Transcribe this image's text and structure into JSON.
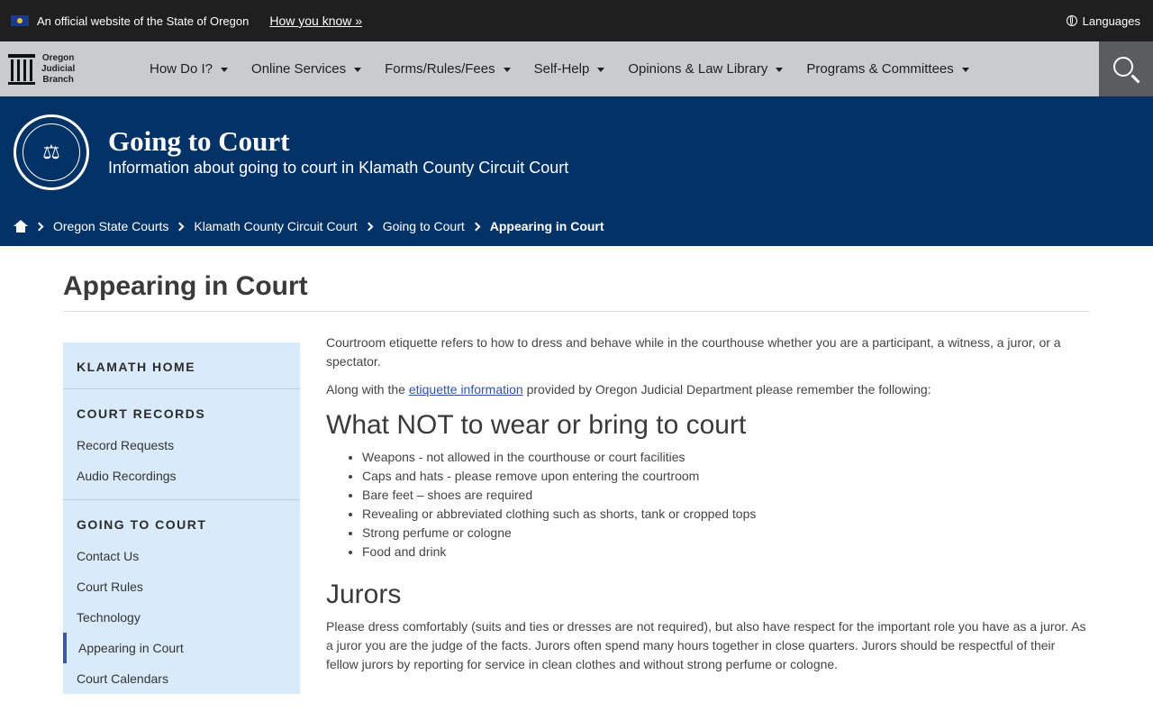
{
  "gov_bar": {
    "official_text": "An official website of the State of Oregon",
    "how_link": "How you know »",
    "languages": "Languages"
  },
  "brand": {
    "line1": "Oregon",
    "line2": "Judicial",
    "line3": "Branch"
  },
  "nav": {
    "items": [
      {
        "label": "How Do I?"
      },
      {
        "label": "Online Services"
      },
      {
        "label": "Forms/Rules/Fees"
      },
      {
        "label": "Self-Help"
      },
      {
        "label": "Opinions & Law Library"
      },
      {
        "label": "Programs & Committees"
      }
    ]
  },
  "banner": {
    "title": "Going to Court",
    "subtitle": "Information about going to court in Klamath County Circuit Court",
    "breadcrumb": [
      "Oregon State Courts",
      "Klamath County Circuit Court",
      "Going to Court",
      "Appearing in Court"
    ]
  },
  "page": {
    "title": "Appearing in Court"
  },
  "sidebar": {
    "home": "KLAMATH HOME",
    "section1": {
      "heading": "COURT RECORDS",
      "links": [
        "Record Requests",
        "Audio Recordings"
      ]
    },
    "section2": {
      "heading": "GOING TO COURT",
      "links": [
        "Contact Us",
        "Court Rules",
        "Technology",
        "Appearing in Court",
        "Court Calendars"
      ]
    }
  },
  "content": {
    "intro": "Courtroom etiquette refers to how to dress and behave while in the courthouse whether you are a participant, a witness, a juror, or a spectator.",
    "along_prefix": "Along with the ",
    "etiquette_link": "etiquette information",
    "along_suffix": " provided by Oregon Judicial Department please remember the following:",
    "h2_wear": "What NOT to wear or bring to court",
    "wear_list": [
      "Weapons - not allowed in the courthouse or court facilities",
      "Caps and hats - please remove upon entering the courtroom",
      "Bare feet – shoes are required",
      "Revealing or abbreviated clothing such as shorts, tank or cropped tops",
      "Strong perfume or cologne",
      "Food and drink"
    ],
    "h2_jurors": "Jurors",
    "jurors_text": "Please dress comfortably (suits and ties or dresses are not required), but also have respect for the important role you have as a juror. As a juror you are the judge of the facts. Jurors often spend many hours together in close quarters. Jurors should be respectful of their fellow jurors by reporting for service in clean clothes and without strong perfume or cologne."
  }
}
